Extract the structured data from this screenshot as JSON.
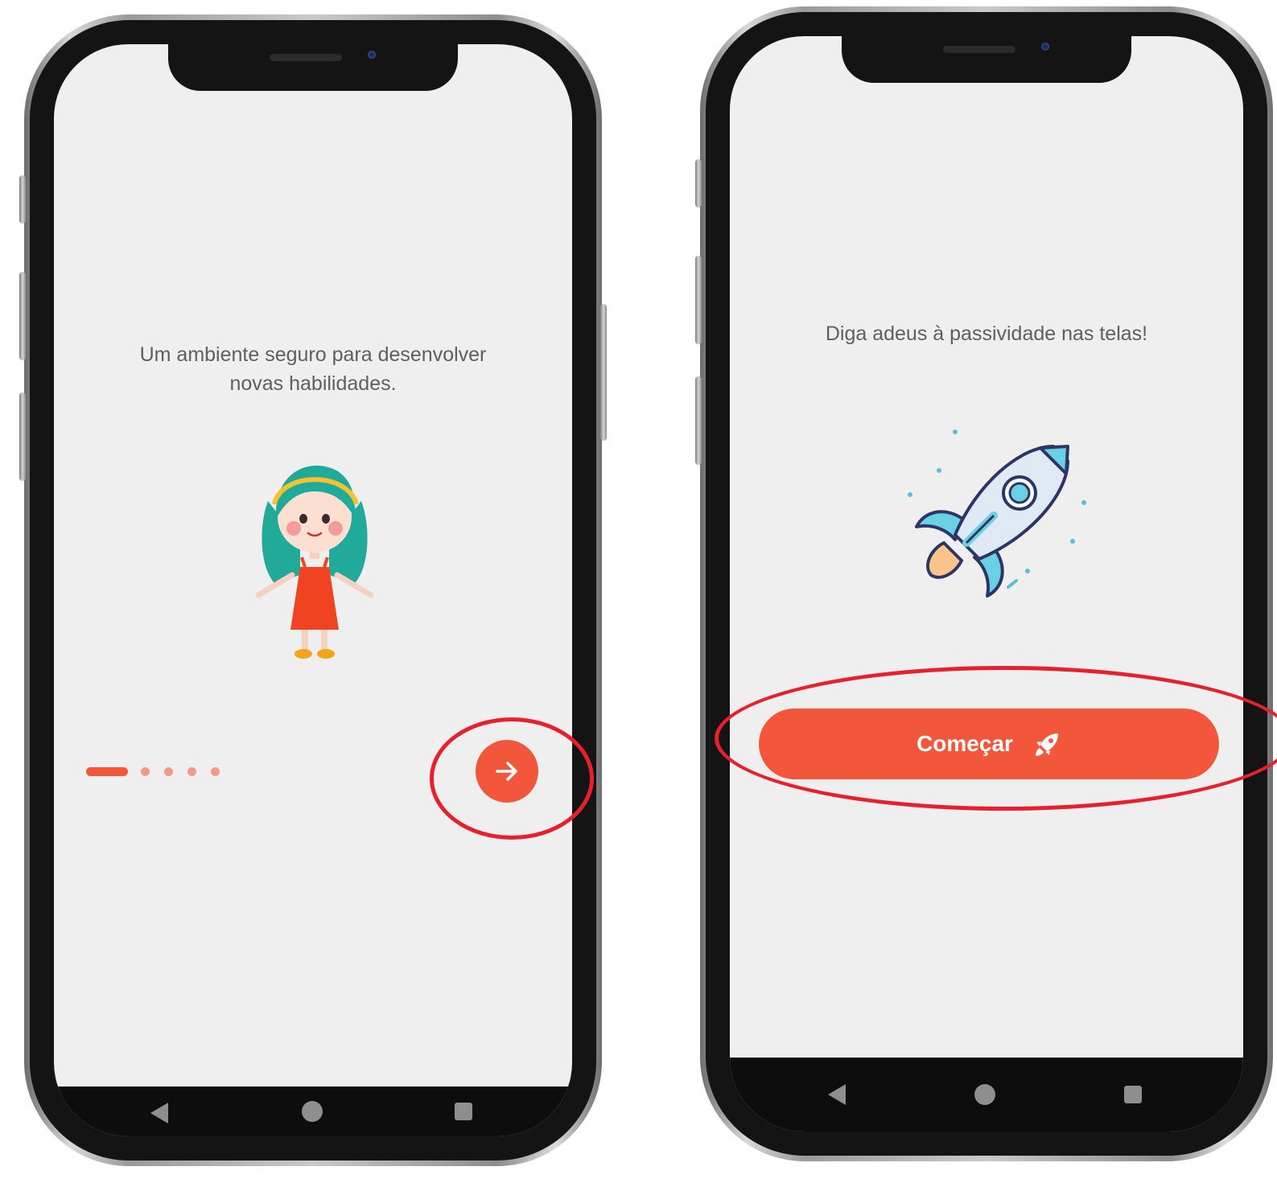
{
  "left_screen": {
    "caption_line1": "Um ambiente seguro para desenvolver",
    "caption_line2": "novas habilidades.",
    "illustration": "girl-illustration",
    "next_button_icon": "arrow-right-icon",
    "page_indicator": {
      "total": 5,
      "current": 1
    }
  },
  "right_screen": {
    "caption": "Diga adeus à passividade nas telas!",
    "illustration": "rocket-illustration",
    "start_button_label": "Começar",
    "start_button_icon": "rocket-icon"
  },
  "nav_bar": {
    "icons": [
      "back-triangle-icon",
      "home-circle-icon",
      "recent-square-icon"
    ]
  },
  "colors": {
    "accent": "#f2573c",
    "accent_light": "#f49a87",
    "screen_bg": "#efefef",
    "caption_text": "#5f5f5f",
    "highlight_ring": "#e8202b",
    "frame_dark": "#141414"
  }
}
